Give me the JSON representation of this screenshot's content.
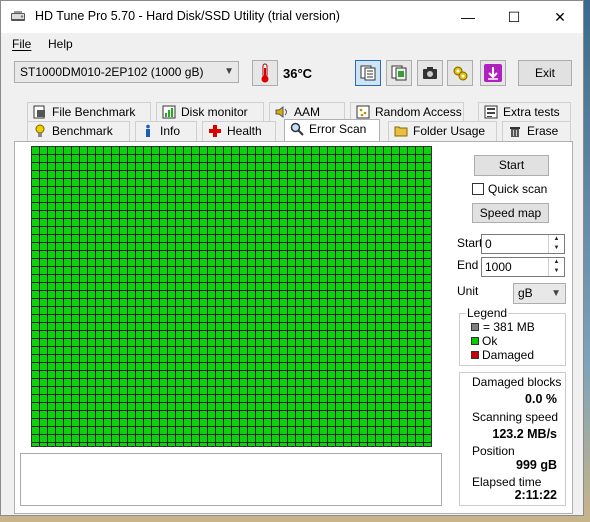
{
  "window": {
    "title": "HD Tune Pro 5.70 - Hard Disk/SSD Utility (trial version)"
  },
  "controls": {
    "minimize": "—",
    "maximize": "☐",
    "close": "✕"
  },
  "menu": {
    "file": "File",
    "help": "Help"
  },
  "toolbar": {
    "drive": "ST1000DM010-2EP102 (1000 gB)",
    "temperature": "36°C",
    "exit_label": "Exit",
    "buttons": [
      "copy-text-icon",
      "copy-info-icon",
      "screenshot-camera-icon",
      "options-tools-icon",
      "save-download-icon"
    ]
  },
  "tabs": {
    "row1": [
      "File Benchmark",
      "Disk monitor",
      "AAM",
      "Random Access",
      "Extra tests"
    ],
    "row2": [
      "Benchmark",
      "Info",
      "Health",
      "Error Scan",
      "Folder Usage",
      "Erase"
    ],
    "selected": "Error Scan"
  },
  "scan": {
    "start_button": "Start",
    "quick_scan_label": "Quick scan",
    "quick_scan_checked": false,
    "speed_map_button": "Speed map",
    "start_label": "Start",
    "start_value": "0",
    "end_label": "End",
    "end_value": "1000",
    "unit_label": "Unit",
    "unit_value": "gB"
  },
  "legend": {
    "title": "Legend",
    "block_size": "= 381 MB",
    "ok": "Ok",
    "damaged": "Damaged",
    "colors": {
      "block": "#808080",
      "ok": "#00cc00",
      "damaged": "#d00000"
    }
  },
  "stats": {
    "damaged_blocks_label": "Damaged blocks",
    "damaged_blocks_value": "0.0 %",
    "scanning_speed_label": "Scanning speed",
    "scanning_speed_value": "123.2 MB/s",
    "position_label": "Position",
    "position_value": "999 gB",
    "elapsed_label": "Elapsed time",
    "elapsed_value": "2:11:22"
  },
  "colors": {
    "scan_ok": "#0bd20b",
    "grid_line": "#1a1a1a",
    "selected_button": "#cde4f7"
  }
}
